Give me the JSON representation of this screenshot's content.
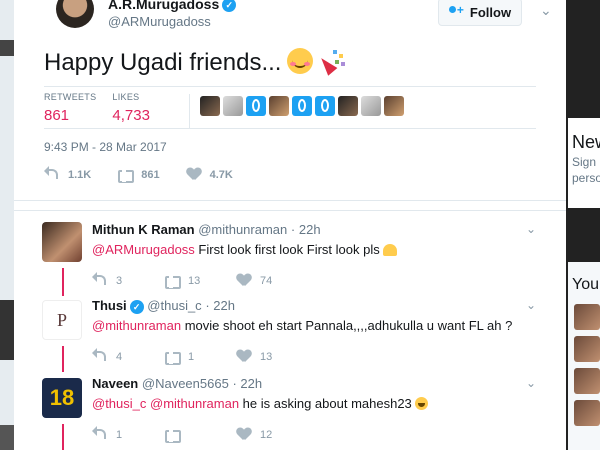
{
  "tweet": {
    "author_name": "A.R.Murugadoss",
    "author_handle": "@ARMurugadoss",
    "follow_label": "Follow",
    "text": "Happy Ugadi friends...",
    "retweets_label": "RETWEETS",
    "retweets_value": "861",
    "likes_label": "LIKES",
    "likes_value": "4,733",
    "timestamp": "9:43 PM - 28 Mar 2017",
    "actions": {
      "replies": "1.1K",
      "retweets": "861",
      "likes": "4.7K"
    }
  },
  "replies": [
    {
      "name": "Mithun K Raman",
      "handle": "@mithunraman",
      "time": "22h",
      "mentions": "@ARMurugadoss",
      "text": " First look first look First look pls",
      "actions": {
        "replies": "3",
        "retweets": "13",
        "likes": "74"
      }
    },
    {
      "name": "Thusi",
      "handle": "@thusi_c",
      "time": "22h",
      "mentions": "@mithunraman",
      "text": " movie shoot eh start Pannala,,,,adhukulla u want FL ah ?",
      "actions": {
        "replies": "4",
        "retweets": "1",
        "likes": "13"
      }
    },
    {
      "name": "Naveen",
      "handle": "@Naveen5665",
      "time": "22h",
      "mentions": "@thusi_c @mithunraman",
      "text": " he is asking about mahesh23",
      "actions": {
        "replies": "1",
        "retweets": "",
        "likes": "12"
      }
    }
  ],
  "background": {
    "panel_big": "New",
    "panel_small": "Sign",
    "panel_small2": "perso",
    "panel2": "You"
  },
  "colors": {
    "accent": "#e0245e",
    "link_blue": "#1da1f2"
  }
}
